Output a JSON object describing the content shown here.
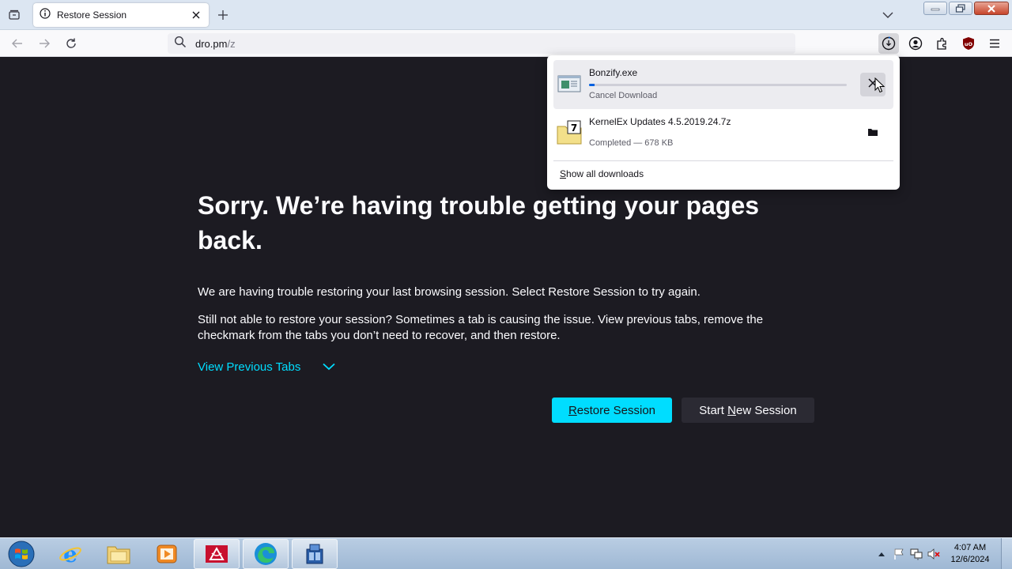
{
  "browser": {
    "tab": {
      "title": "Restore Session"
    },
    "url": {
      "host": "dro.pm",
      "path": "/z"
    }
  },
  "page": {
    "heading": "Sorry. We’re having trouble getting your pages back.",
    "para1": "We are having trouble restoring your last browsing session. Select Restore Session to try again.",
    "para2": "Still not able to restore your session? Sometimes a tab is causing the issue. View previous tabs, remove the checkmark from the tabs you don’t need to recover, and then restore.",
    "view_previous": "View Previous Tabs",
    "restore_button": {
      "pre": "",
      "key": "R",
      "post": "estore Session"
    },
    "new_session_button": {
      "pre": "Start ",
      "key": "N",
      "post": "ew Session"
    }
  },
  "downloads": {
    "items": [
      {
        "name": "Bonzify.exe",
        "status": "Cancel Download",
        "progress_percent": 2,
        "action_icon": "close-icon"
      },
      {
        "name": "KernelEx Updates 4.5.2019.24.7z",
        "status": "Completed — 678 KB",
        "action_icon": "folder-icon"
      }
    ],
    "show_all": {
      "key": "S",
      "post": "how all downloads"
    }
  },
  "taskbar": {
    "apps": [
      "internet-explorer-icon",
      "file-explorer-icon",
      "media-player-icon",
      "acrobat-icon",
      "edge-icon",
      "app-icon"
    ],
    "time": "4:07 AM",
    "date": "12/6/2024"
  },
  "colors": {
    "accent": "#00ddff",
    "page_bg": "#1c1b22",
    "progress": "#0061e0"
  }
}
